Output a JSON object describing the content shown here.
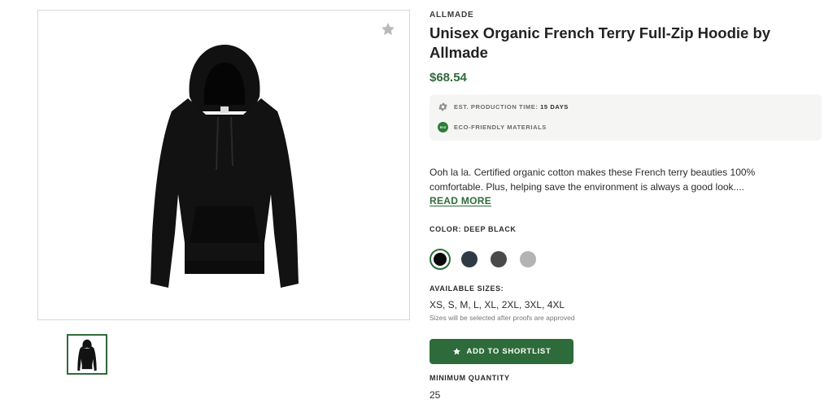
{
  "product": {
    "brand": "ALLMADE",
    "title": "Unisex Organic French Terry Full-Zip Hoodie by Allmade",
    "price": "$68.54"
  },
  "attributes": {
    "production_label": "EST. PRODUCTION TIME:",
    "production_value": "15 DAYS",
    "eco_badge": "ECO",
    "eco_label": "ECO-FRIENDLY MATERIALS"
  },
  "description": {
    "text": "Ooh la la. Certified organic cotton makes these French terry beauties 100% comfortable. Plus, helping save the environment is always a good look....",
    "read_more": "READ MORE"
  },
  "color": {
    "label": "COLOR: DEEP BLACK",
    "swatches": [
      {
        "name": "Deep Black",
        "hex": "#0a0a0a",
        "selected": true
      },
      {
        "name": "Navy",
        "hex": "#2f3a44",
        "selected": false
      },
      {
        "name": "Charcoal",
        "hex": "#4a4a4a",
        "selected": false
      },
      {
        "name": "Heather Grey",
        "hex": "#b3b3b3",
        "selected": false
      }
    ]
  },
  "sizes": {
    "label": "AVAILABLE SIZES:",
    "list": "XS, S, M, L, XL, 2XL, 3XL, 4XL",
    "note": "Sizes will be selected after proofs are approved"
  },
  "actions": {
    "shortlist_label": "ADD TO SHORTLIST"
  },
  "quantity": {
    "label": "MINIMUM QUANTITY",
    "value": "25"
  },
  "icons": {
    "favorite": "star-icon",
    "production": "gear-icon",
    "eco": "eco-badge-icon",
    "shortlist": "star-icon"
  },
  "theme": {
    "accent": "#2e6b3a",
    "eco_green": "#2e7d3a",
    "attr_bg": "#f5f5f4"
  }
}
